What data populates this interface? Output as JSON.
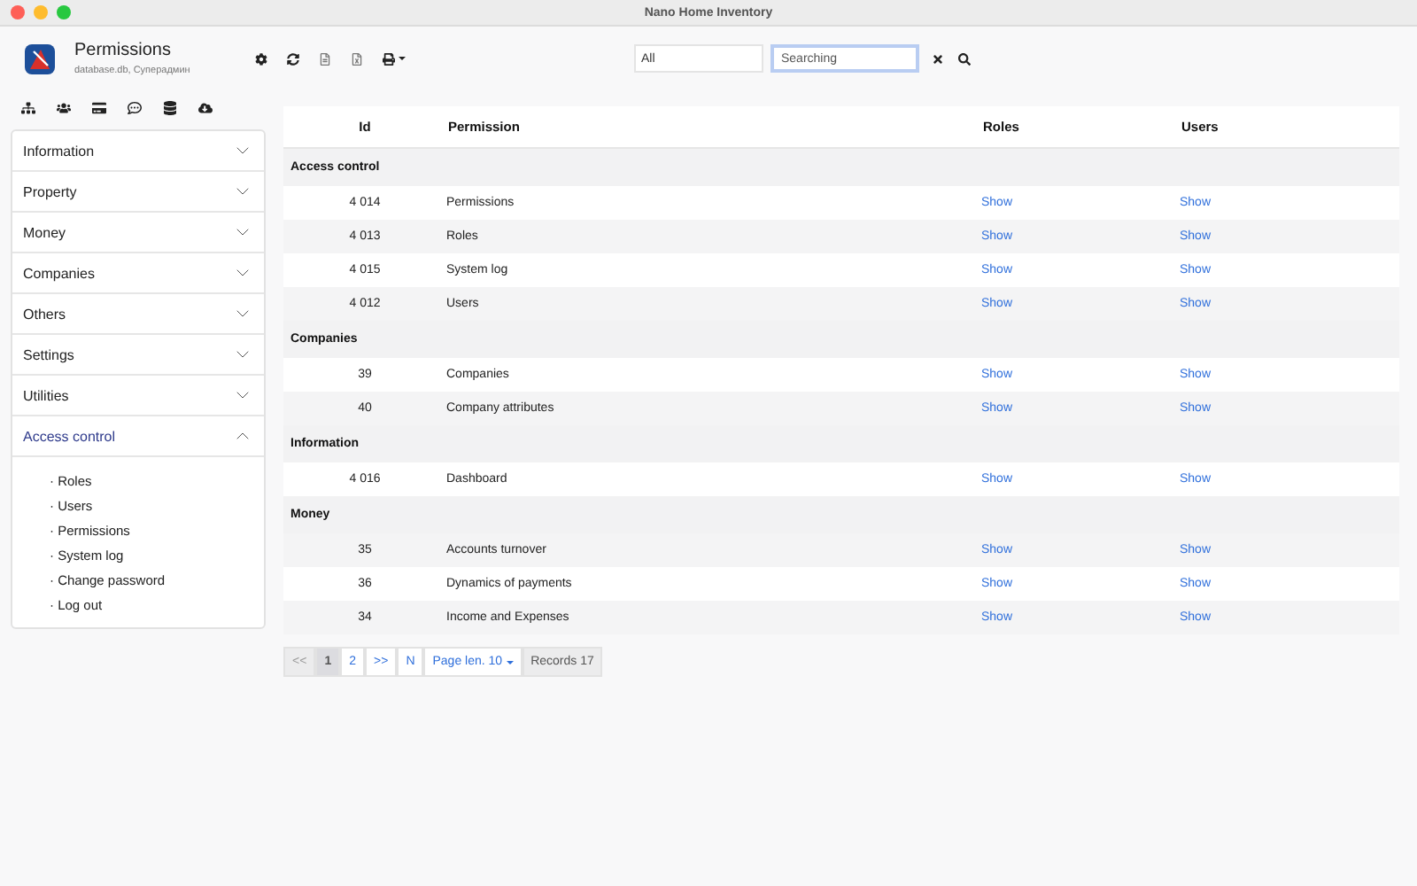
{
  "window": {
    "title": "Nano Home Inventory"
  },
  "header": {
    "title": "Permissions",
    "subtitle": "database.db, Суперадмин"
  },
  "filter": {
    "value": "All"
  },
  "search": {
    "placeholder": "Searching"
  },
  "sidebar": {
    "sections": [
      {
        "label": "Information",
        "expanded": false
      },
      {
        "label": "Property",
        "expanded": false
      },
      {
        "label": "Money",
        "expanded": false
      },
      {
        "label": "Companies",
        "expanded": false
      },
      {
        "label": "Others",
        "expanded": false
      },
      {
        "label": "Settings",
        "expanded": false
      },
      {
        "label": "Utilities",
        "expanded": false
      },
      {
        "label": "Access control",
        "expanded": true,
        "items": [
          "· Roles",
          "· Users",
          "· Permissions",
          "· System log",
          "· Change password",
          "· Log out"
        ]
      }
    ]
  },
  "table": {
    "columns": [
      "Id",
      "Permission",
      "Roles",
      "Users"
    ],
    "groups": [
      {
        "name": "Access control",
        "rows": [
          {
            "id": "4 014",
            "permission": "Permissions",
            "roles": "Show",
            "users": "Show"
          },
          {
            "id": "4 013",
            "permission": "Roles",
            "roles": "Show",
            "users": "Show"
          },
          {
            "id": "4 015",
            "permission": "System log",
            "roles": "Show",
            "users": "Show"
          },
          {
            "id": "4 012",
            "permission": "Users",
            "roles": "Show",
            "users": "Show"
          }
        ]
      },
      {
        "name": "Companies",
        "rows": [
          {
            "id": "39",
            "permission": "Companies",
            "roles": "Show",
            "users": "Show"
          },
          {
            "id": "40",
            "permission": "Company attributes",
            "roles": "Show",
            "users": "Show"
          }
        ]
      },
      {
        "name": "Information",
        "rows": [
          {
            "id": "4 016",
            "permission": "Dashboard",
            "roles": "Show",
            "users": "Show"
          }
        ]
      },
      {
        "name": "Money",
        "rows": [
          {
            "id": "35",
            "permission": "Accounts turnover",
            "roles": "Show",
            "users": "Show"
          },
          {
            "id": "36",
            "permission": "Dynamics of payments",
            "roles": "Show",
            "users": "Show"
          },
          {
            "id": "34",
            "permission": "Income and Expenses",
            "roles": "Show",
            "users": "Show"
          }
        ]
      }
    ]
  },
  "pager": {
    "pages": [
      {
        "label": "<<",
        "disabled": true,
        "selected": false
      },
      {
        "label": "1",
        "disabled": false,
        "selected": true
      },
      {
        "label": "2",
        "disabled": false,
        "selected": false
      },
      {
        "label": ">>",
        "disabled": false,
        "selected": false
      },
      {
        "label": "N",
        "disabled": false,
        "selected": false
      }
    ],
    "page_length": "Page len. 10",
    "records": "Records 17"
  }
}
